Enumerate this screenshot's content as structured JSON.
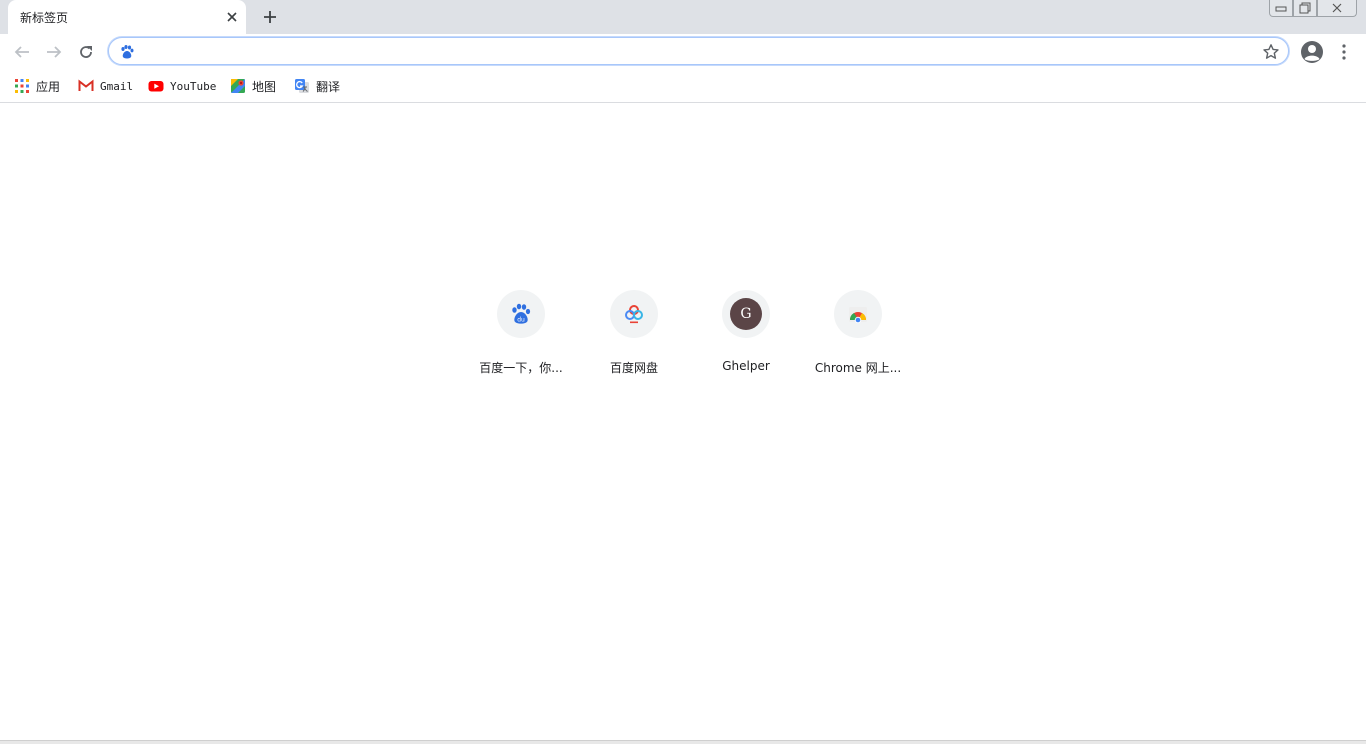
{
  "tab": {
    "title": "新标签页"
  },
  "bookmarks": [
    {
      "label": "应用",
      "icon": "apps-grid-icon"
    },
    {
      "label": "Gmail",
      "icon": "gmail-icon"
    },
    {
      "label": "YouTube",
      "icon": "youtube-icon"
    },
    {
      "label": "地图",
      "icon": "maps-icon"
    },
    {
      "label": "翻译",
      "icon": "translate-icon"
    }
  ],
  "omnibox": {
    "value": "",
    "search_engine_icon": "baidu-icon"
  },
  "shortcuts": [
    {
      "label": "百度一下，你...",
      "icon": "baidu-icon"
    },
    {
      "label": "百度网盘",
      "icon": "baidu-netdisk-icon"
    },
    {
      "label": "Ghelper",
      "icon": "ghelper-letter-icon",
      "letter": "G"
    },
    {
      "label": "Chrome 网上...",
      "icon": "chrome-web-store-icon"
    }
  ],
  "colors": {
    "accent": "#1a73e8",
    "tabstrip": "#dee1e6",
    "tile_bg": "#f1f3f4"
  }
}
